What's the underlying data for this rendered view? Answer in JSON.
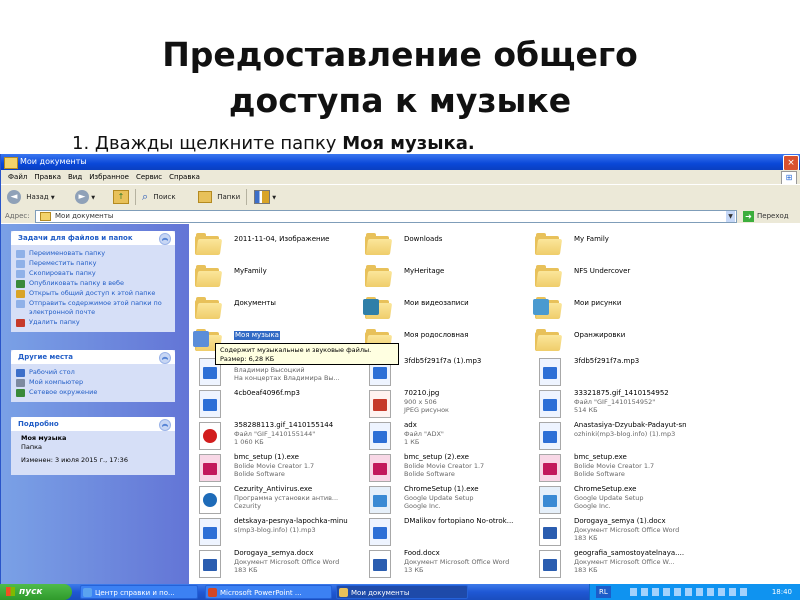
{
  "slide": {
    "title_line1": "Предоставление общего",
    "title_line2": "доступа к музыке",
    "step_number": "1.",
    "step_text": "Дважды щелкните папку",
    "step_bold": "Моя музыка."
  },
  "window": {
    "title": "Мои документы",
    "close_symbol": "×"
  },
  "menubar": [
    "Файл",
    "Правка",
    "Вид",
    "Избранное",
    "Сервис",
    "Справка"
  ],
  "toolbar": {
    "back_label": "Назад",
    "search_label": "Поиск",
    "folders_label": "Папки"
  },
  "address": {
    "label": "Адрес:",
    "value": "Мои документы",
    "go_label": "Переход"
  },
  "left_panel": {
    "tasks": {
      "header": "Задачи для файлов и папок",
      "items": [
        "Переименовать папку",
        "Переместить папку",
        "Скопировать папку",
        "Опубликовать папку в вебе",
        "Открыть общий доступ к этой папке",
        "Отправить содержимое этой папки по электронной почте",
        "Удалить папку"
      ]
    },
    "places": {
      "header": "Другие места",
      "items": [
        "Рабочий стол",
        "Мой компьютер",
        "Сетевое окружение"
      ]
    },
    "details": {
      "header": "Подробно",
      "name": "Моя музыка",
      "type": "Папка",
      "modified": "Изменен: 3 июля 2015 г., 17:36"
    }
  },
  "items": [
    {
      "name": "2011-11-04, Изображение",
      "kind": "folder"
    },
    {
      "name": "Downloads",
      "kind": "folder"
    },
    {
      "name": "My Family",
      "kind": "folder"
    },
    {
      "name": "MyFamily",
      "kind": "folder"
    },
    {
      "name": "MyHeritage",
      "kind": "folder"
    },
    {
      "name": "NFS Undercover",
      "kind": "folder"
    },
    {
      "name": "Документы",
      "kind": "folder"
    },
    {
      "name": "Мои видеозаписи",
      "kind": "folder-video"
    },
    {
      "name": "Мои рисунки",
      "kind": "folder-pictures"
    },
    {
      "name": "Моя музыка",
      "kind": "folder-music"
    },
    {
      "name": "Моя родословная",
      "kind": "folder"
    },
    {
      "name": "Оранжировки",
      "kind": "folder"
    },
    {
      "name": "",
      "line2": "Владимир Высоцкий",
      "line3": "На концертах Владимира Вы...",
      "kind": "media"
    },
    {
      "name": "3fdb5f291f7a (1).mp3",
      "kind": "media"
    },
    {
      "name": "3fdb5f291f7a.mp3",
      "kind": "media"
    },
    {
      "name": "4cb0eaf4096f.mp3",
      "kind": "media"
    },
    {
      "name": "70210.jpg",
      "line2": "900 x 506",
      "line3": "JPEG рисунок",
      "kind": "image"
    },
    {
      "name": "33321875.gif_1410154952",
      "line2": "Файл \"GIF_1410154952\"",
      "line3": "514 КБ",
      "kind": "gif"
    },
    {
      "name": "358288113.gif_1410155144",
      "line2": "Файл \"GIF_1410155144\"",
      "line3": "1 060 КБ",
      "kind": "opera"
    },
    {
      "name": "adx",
      "line2": "Файл \"ADX\"",
      "line3": "1 КБ",
      "kind": "media"
    },
    {
      "name": "Anastasiya-Dzyubak-Padayut-sn",
      "line2": "ozhinki(mp3-blog.info) (1).mp3",
      "kind": "media"
    },
    {
      "name": "bmc_setup (1).exe",
      "line2": "Bolide Movie Creator 1.7",
      "line3": "Bolide Software",
      "kind": "film"
    },
    {
      "name": "bmc_setup (2).exe",
      "line2": "Bolide Movie Creator 1.7",
      "line3": "Bolide Software",
      "kind": "film"
    },
    {
      "name": "bmc_setup.exe",
      "line2": "Bolide Movie Creator 1.7",
      "line3": "Bolide Software",
      "kind": "film"
    },
    {
      "name": "Cezurity_Antivirus.exe",
      "line2": "Программа установки антив...",
      "line3": "Cezurity",
      "kind": "cezurity"
    },
    {
      "name": "ChromeSetup (1).exe",
      "line2": "Google Update Setup",
      "line3": "Google Inc.",
      "kind": "setup"
    },
    {
      "name": "ChromeSetup.exe",
      "line2": "Google Update Setup",
      "line3": "Google Inc.",
      "kind": "setup"
    },
    {
      "name": "detskaya-pesnya-lapochka-minu",
      "line2": "s(mp3-blog.info) (1).mp3",
      "kind": "media"
    },
    {
      "name": "DMalikov fortopiano No-otrok...",
      "kind": "media"
    },
    {
      "name": "Dorogaya_semya (1).docx",
      "line2": "Документ Microsoft Office Word",
      "line3": "183 КБ",
      "kind": "doc"
    },
    {
      "name": "Dorogaya_semya.docx",
      "line2": "Документ Microsoft Office Word",
      "line3": "183 КБ",
      "kind": "doc"
    },
    {
      "name": "Food.docx",
      "line2": "Документ Microsoft Office Word",
      "line3": "13 КБ",
      "kind": "doc"
    },
    {
      "name": "geografia_samostoyatelnaya....",
      "line2": "Документ Microsoft Office W...",
      "line3": "183 КБ",
      "kind": "doc"
    }
  ],
  "tooltip": {
    "line1": "Содержит музыкальные и звуковые файлы.",
    "line2": "Размер: 6,28 КБ"
  },
  "taskbar": {
    "start_label": "пуск",
    "tasks": [
      "Центр справки и по...",
      "Microsoft PowerPoint ...",
      "Мои документы"
    ],
    "lang": "RL",
    "clock": "18:40"
  },
  "colors": {
    "xp_blue": "#0a48d8",
    "panel_blue": "#6375d6",
    "folder_yellow": "#e8c15a",
    "selection": "#316ac5"
  }
}
